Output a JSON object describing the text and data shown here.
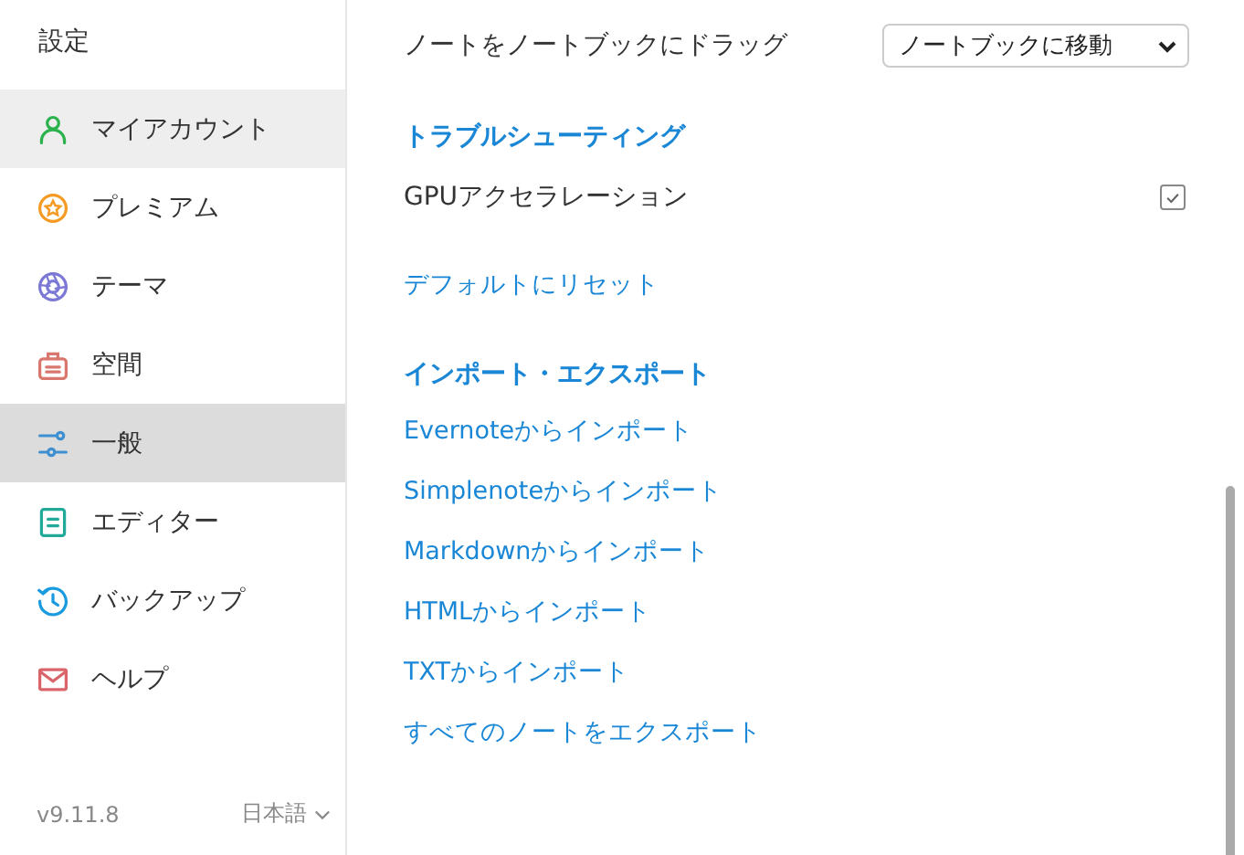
{
  "sidebar": {
    "title": "設定",
    "items": [
      {
        "label": "マイアカウント",
        "kind": "person",
        "color": "#2bb24c",
        "selected": false,
        "hovered": true
      },
      {
        "label": "プレミアム",
        "kind": "star",
        "color": "#f59a23",
        "selected": false,
        "hovered": false
      },
      {
        "label": "テーマ",
        "kind": "aperture",
        "color": "#7b78d6",
        "selected": false,
        "hovered": false
      },
      {
        "label": "空間",
        "kind": "briefcase",
        "color": "#d9776f",
        "selected": false,
        "hovered": false
      },
      {
        "label": "一般",
        "kind": "sliders",
        "color": "#3d8fd1",
        "selected": true,
        "hovered": false
      },
      {
        "label": "エディター",
        "kind": "document",
        "color": "#21a99a",
        "selected": false,
        "hovered": false
      },
      {
        "label": "バックアップ",
        "kind": "clock",
        "color": "#1a9be0",
        "selected": false,
        "hovered": false
      },
      {
        "label": "ヘルプ",
        "kind": "mail",
        "color": "#d9646a",
        "selected": false,
        "hovered": false
      }
    ],
    "version": "v9.11.8",
    "language": "日本語"
  },
  "content": {
    "drag_setting": {
      "label": "ノートをノートブックにドラッグ",
      "value": "ノートブックに移動"
    },
    "troubleshooting": {
      "heading": "トラブルシューティング",
      "gpu": {
        "label": "GPUアクセラレーション",
        "checked": true
      },
      "reset_link": "デフォルトにリセット"
    },
    "import_export": {
      "heading": "インポート・エクスポート",
      "links": [
        "Evernoteからインポート",
        "Simplenoteからインポート",
        "Markdownからインポート",
        "HTMLからインポート",
        "TXTからインポート",
        "すべてのノートをエクスポート"
      ]
    }
  }
}
